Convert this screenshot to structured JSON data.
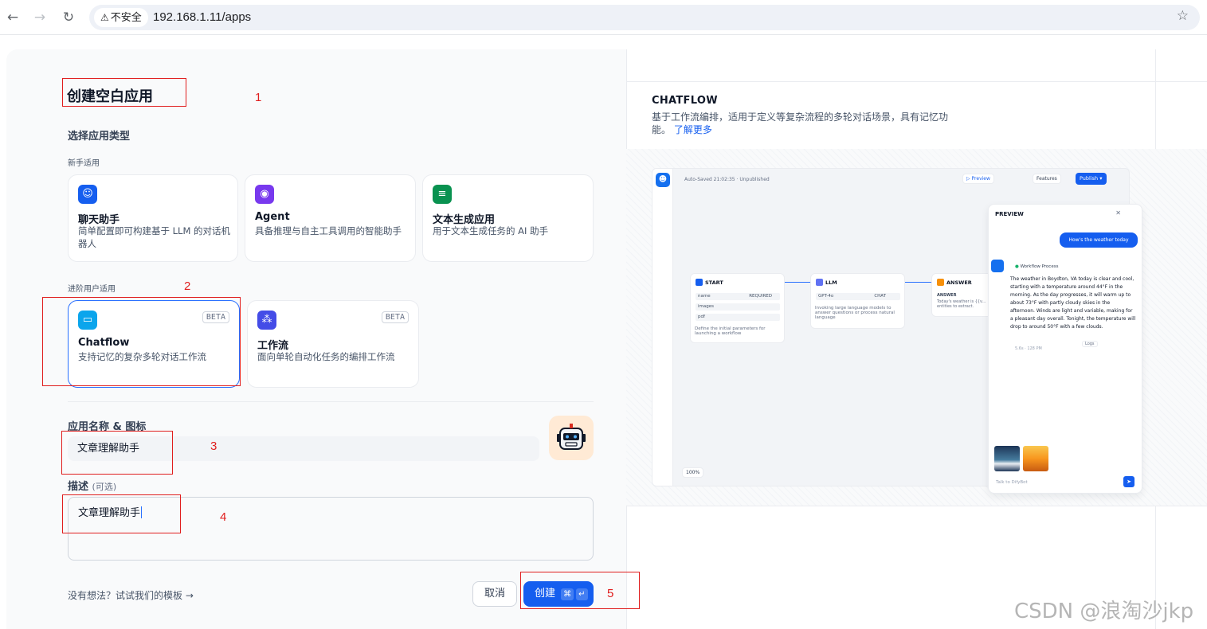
{
  "browser": {
    "security_label": "不安全",
    "url": "192.168.1.11/apps"
  },
  "form": {
    "title": "创建空白应用",
    "choose_type_label": "选择应用类型",
    "beginner_label": "新手适用",
    "advanced_label": "进阶用户适用",
    "beginner_cards": [
      {
        "title": "聊天助手",
        "desc": "简单配置即可构建基于 LLM 的对话机器人",
        "icon": "chat-bot-icon",
        "color": "#155eef"
      },
      {
        "title": "Agent",
        "desc": "具备推理与自主工具调用的智能助手",
        "icon": "agent-icon",
        "color": "#7839ee"
      },
      {
        "title": "文本生成应用",
        "desc": "用于文本生成任务的 AI 助手",
        "icon": "text-generation-icon",
        "color": "#099250"
      }
    ],
    "advanced_cards": [
      {
        "title": "Chatflow",
        "desc": "支持记忆的复杂多轮对话工作流",
        "badge": "BETA",
        "icon": "chatflow-icon",
        "color": "#0ba5ec",
        "selected": true
      },
      {
        "title": "工作流",
        "desc": "面向单轮自动化任务的编排工作流",
        "badge": "BETA",
        "icon": "workflow-icon",
        "color": "#444ce7",
        "selected": false
      }
    ],
    "name_label": "应用名称 & 图标",
    "name_value": "文章理解助手",
    "desc_label": "描述",
    "desc_optional": "(可选)",
    "desc_value": "文章理解助手",
    "templates_link": "没有想法？试试我们的模板",
    "cancel_label": "取消",
    "create_label": "创建",
    "create_kbd_1": "⌘",
    "create_kbd_2": "↵"
  },
  "annotations": [
    "1",
    "2",
    "3",
    "4",
    "5"
  ],
  "preview": {
    "title": "CHATFLOW",
    "desc": "基于工作流编排，适用于定义等复杂流程的多轮对话场景，具有记忆功能。",
    "learn_more": "了解更多",
    "autosave": "Auto-Saved 21:02:35 · Unpublished",
    "btn_preview": "Preview",
    "btn_features": "Features",
    "btn_publish": "Publish",
    "panel_title": "PREVIEW",
    "node_start": "START",
    "node_start_rows": [
      "name",
      "images",
      "pdf"
    ],
    "node_start_req": "REQUIRED",
    "node_start_desc": "Define the initial parameters for launching a workflow",
    "node_llm": "LLM",
    "node_llm_model": "GPT-4o",
    "node_llm_tag": "CHAT",
    "node_llm_desc": "Invoking large language models to answer questions or process natural language",
    "node_answer": "ANSWER",
    "node_answer_sub": "ANSWER",
    "node_answer_text": "Today's weather is {{v... entities to extract.",
    "user_msg": "How's the weather today",
    "workflow_process": "Workflow Process",
    "bot_msg": "The weather in Boydton, VA today is clear and cool, starting with a temperature around 44°F in the morning. As the day progresses, it will warm up to about 73°F with partly cloudy skies in the afternoon. Winds are light and variable, making for a pleasant day overall. Tonight, the temperature will drop to around 50°F with a few clouds.",
    "bot_meta": "5.6s · 128 PM",
    "logs": "Logs",
    "zoom": "100%",
    "input_placeholder": "Talk to DifyBot"
  },
  "watermark": "CSDN @浪淘沙jkp"
}
